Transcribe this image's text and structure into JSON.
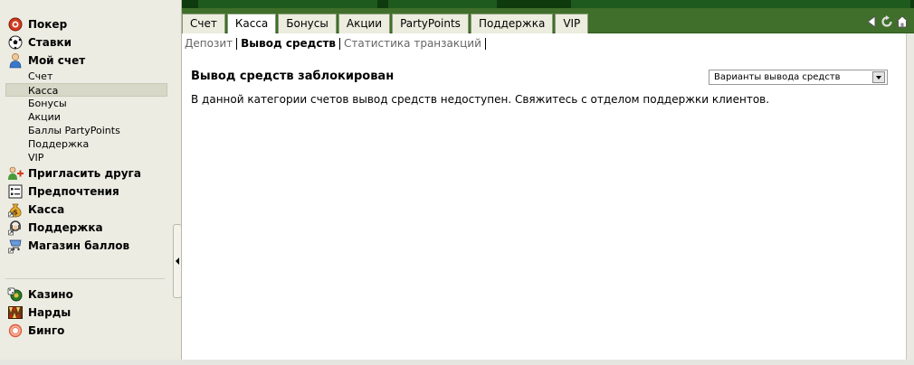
{
  "sidebar": {
    "items": [
      {
        "label": "Покер",
        "icon": "poker-chip-icon"
      },
      {
        "label": "Ставки",
        "icon": "soccer-ball-icon"
      },
      {
        "label": "Мой счет",
        "icon": "user-icon"
      }
    ],
    "account_sub": [
      "Счет",
      "Касса",
      "Бонусы",
      "Акции",
      "Баллы PartyPoints",
      "Поддержка",
      "VIP"
    ],
    "active_sub": "Касса",
    "more_items": [
      {
        "label": "Пригласить друга",
        "icon": "invite-friend-icon"
      },
      {
        "label": "Предпочтения",
        "icon": "preferences-icon"
      },
      {
        "label": "Касса",
        "icon": "money-bag-icon"
      },
      {
        "label": "Поддержка",
        "icon": "support-icon"
      },
      {
        "label": "Магазин баллов",
        "icon": "points-shop-icon"
      }
    ],
    "bottom_items": [
      {
        "label": "Казино",
        "icon": "casino-icon"
      },
      {
        "label": "Нарды",
        "icon": "backgammon-icon"
      },
      {
        "label": "Бинго",
        "icon": "bingo-icon"
      }
    ]
  },
  "tabs": [
    "Счет",
    "Касса",
    "Бонусы",
    "Акции",
    "PartyPoints",
    "Поддержка",
    "VIP"
  ],
  "active_tab": "Касса",
  "subtabs": [
    "Депозит",
    "Вывод средств",
    "Статистика транзакций"
  ],
  "active_subtab": "Вывод средств",
  "content": {
    "title": "Вывод средств заблокирован",
    "message": "В данной категории счетов вывод средств недоступен. Свяжитесь с отделом поддержки клиентов.",
    "select_value": "Варианты вывода средств"
  },
  "colors": {
    "tabbar_green": "#3f6f2a",
    "top_dark_green": "#0e3a0e",
    "sidebar_bg": "#ecece3"
  }
}
